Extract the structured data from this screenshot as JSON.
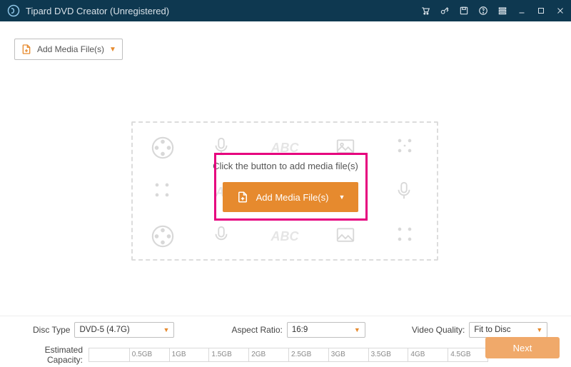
{
  "titlebar": {
    "title": "Tipard DVD Creator (Unregistered)"
  },
  "topButton": {
    "label": "Add Media File(s)"
  },
  "center": {
    "prompt": "Click the button to add media file(s)",
    "button_label": "Add Media File(s)",
    "watermark_text": "ABC"
  },
  "bottom": {
    "discTypeLabel": "Disc Type",
    "discTypeValue": "DVD-5 (4.7G)",
    "aspectLabel": "Aspect Ratio:",
    "aspectValue": "16:9",
    "qualityLabel": "Video Quality:",
    "qualityValue": "Fit to Disc",
    "capacityLabel": "Estimated Capacity:",
    "ticks": [
      "0.5GB",
      "1GB",
      "1.5GB",
      "2GB",
      "2.5GB",
      "3GB",
      "3.5GB",
      "4GB",
      "4.5GB"
    ],
    "nextLabel": "Next"
  }
}
